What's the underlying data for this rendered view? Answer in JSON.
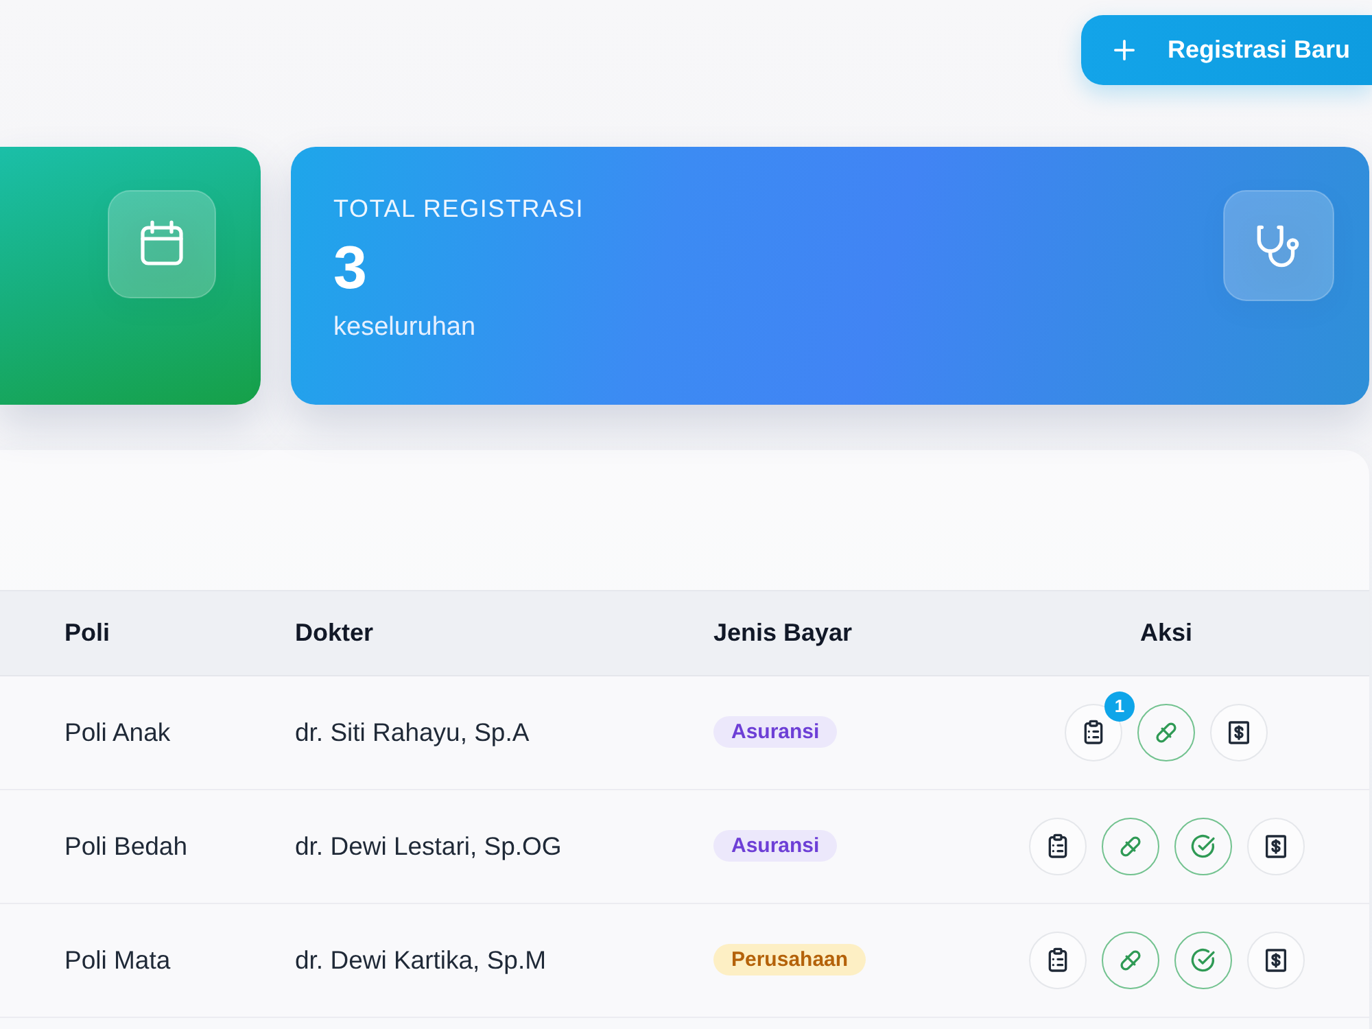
{
  "header": {
    "new_button": {
      "label": "Registrasi Baru"
    }
  },
  "stat_cards": [
    {
      "kind": "schedule"
    },
    {
      "kind": "total",
      "title": "TOTAL REGISTRASI",
      "value": "3",
      "caption": "keseluruhan"
    }
  ],
  "table": {
    "columns": [
      "Poli",
      "Dokter",
      "Jenis Bayar",
      "Aksi"
    ],
    "rows": [
      {
        "poli": "Poli Anak",
        "dokter": "dr. Siti Rahayu, Sp.A",
        "payment": {
          "label": "Asuransi",
          "kind": "insurance"
        },
        "actions": [
          {
            "kind": "record",
            "count": "1"
          },
          {
            "kind": "medication"
          },
          {
            "kind": "billing"
          }
        ]
      },
      {
        "poli": "Poli Bedah",
        "dokter": "dr. Dewi Lestari, Sp.OG",
        "payment": {
          "label": "Asuransi",
          "kind": "insurance"
        },
        "actions": [
          {
            "kind": "record"
          },
          {
            "kind": "medication"
          },
          {
            "kind": "complete"
          },
          {
            "kind": "billing"
          }
        ]
      },
      {
        "poli": "Poli Mata",
        "dokter": "dr. Dewi Kartika, Sp.M",
        "payment": {
          "label": "Perusahaan",
          "kind": "company"
        },
        "actions": [
          {
            "kind": "record"
          },
          {
            "kind": "medication"
          },
          {
            "kind": "complete"
          },
          {
            "kind": "billing"
          }
        ]
      }
    ]
  }
}
